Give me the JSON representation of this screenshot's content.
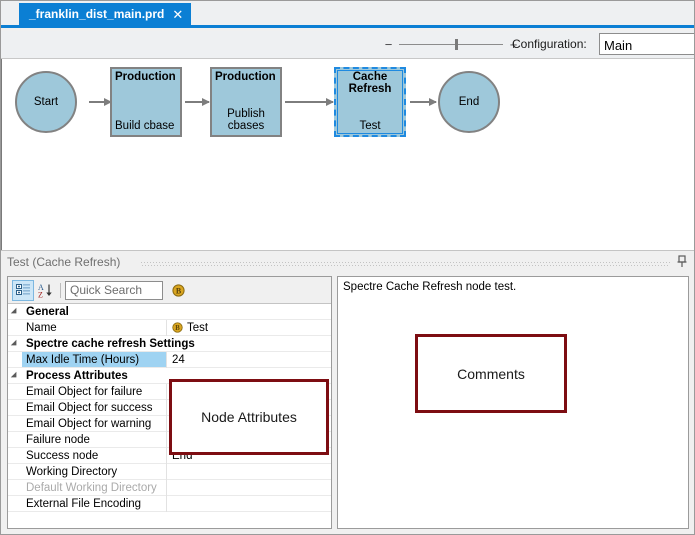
{
  "tab": {
    "title": "_franklin_dist_main.prd",
    "close_label": "✕"
  },
  "toolbar": {
    "zoom_out_label": "−",
    "zoom_in_label": "+",
    "configuration_label": "Configuration:",
    "configuration_value": "Main",
    "configuration_placeholder": "Main"
  },
  "diagram": {
    "nodes": [
      {
        "id": "start",
        "shape": "circle",
        "label": "Start",
        "selected": false
      },
      {
        "id": "build",
        "shape": "box",
        "top": "Production",
        "bottom": "Build cbase",
        "selected": false
      },
      {
        "id": "publish",
        "shape": "box",
        "top": "Production",
        "bottom": "Publish\ncbases",
        "bottom_line1": "Publish",
        "bottom_line2": "cbases",
        "selected": false
      },
      {
        "id": "cache",
        "shape": "box",
        "top_line1": "Cache",
        "top_line2": "Refresh",
        "bottom": "Test",
        "selected": true
      },
      {
        "id": "end",
        "shape": "circle",
        "label": "End",
        "selected": false
      }
    ]
  },
  "panel": {
    "caption": "Test (Cache Refresh)",
    "pin_title": "Auto Hide"
  },
  "properties": {
    "toolbar": {
      "categorized_title": "Categorized",
      "alphabetical_title": "Alphabetical",
      "search_placeholder": "Quick Search",
      "search_value": ""
    },
    "rows": [
      {
        "type": "category",
        "name": "General"
      },
      {
        "type": "property",
        "name": "Name",
        "value": "Test",
        "badge": true,
        "selected": false,
        "disabled": false
      },
      {
        "type": "category",
        "name": "Spectre cache refresh Settings"
      },
      {
        "type": "property",
        "name": "Max Idle Time (Hours)",
        "value": "24",
        "badge": false,
        "selected": true,
        "disabled": false
      },
      {
        "type": "category",
        "name": "Process Attributes"
      },
      {
        "type": "property",
        "name": "Email Object for failure",
        "value": "",
        "badge": false,
        "selected": false,
        "disabled": false
      },
      {
        "type": "property",
        "name": "Email Object for success",
        "value": "",
        "badge": false,
        "selected": false,
        "disabled": false
      },
      {
        "type": "property",
        "name": "Email Object for warning",
        "value": "",
        "badge": false,
        "selected": false,
        "disabled": false
      },
      {
        "type": "property",
        "name": "Failure node",
        "value": "",
        "badge": false,
        "selected": false,
        "disabled": false
      },
      {
        "type": "property",
        "name": "Success node",
        "value": "End",
        "badge": false,
        "selected": false,
        "disabled": false
      },
      {
        "type": "property",
        "name": "Working Directory",
        "value": "",
        "badge": false,
        "selected": false,
        "disabled": false
      },
      {
        "type": "property",
        "name": "Default Working Directory",
        "value": "",
        "badge": false,
        "selected": false,
        "disabled": true
      },
      {
        "type": "property",
        "name": "External File Encoding",
        "value": "",
        "badge": false,
        "selected": false,
        "disabled": false
      }
    ]
  },
  "comments": {
    "text": "Spectre Cache Refresh node test."
  },
  "annotations": {
    "node_attributes": "Node Attributes",
    "comments": "Comments",
    "border_color": "#7d0d12"
  },
  "colors": {
    "tab_blue": "#0b7fd4",
    "node_fill": "#9ec8da",
    "node_border": "#828282",
    "selection_blue": "#1f8ae0",
    "grid_selection": "#9fd3f2"
  }
}
